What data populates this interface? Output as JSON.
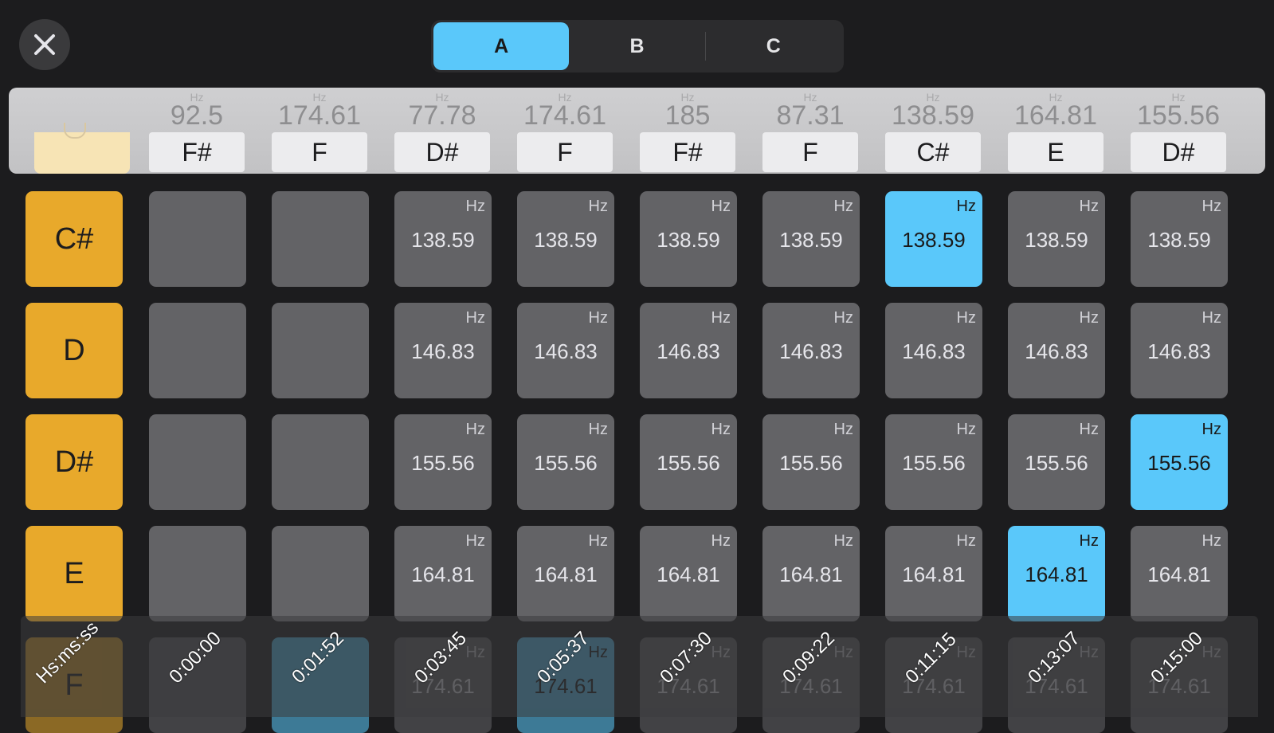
{
  "segments": {
    "a": "A",
    "b": "B",
    "c": "C"
  },
  "header": {
    "unit": "Hz",
    "columns": [
      {
        "freq": "92.5",
        "note": "F#"
      },
      {
        "freq": "174.61",
        "note": "F"
      },
      {
        "freq": "77.78",
        "note": "D#"
      },
      {
        "freq": "174.61",
        "note": "F"
      },
      {
        "freq": "185",
        "note": "F#"
      },
      {
        "freq": "87.31",
        "note": "F"
      },
      {
        "freq": "138.59",
        "note": "C#"
      },
      {
        "freq": "164.81",
        "note": "E"
      },
      {
        "freq": "155.56",
        "note": "D#"
      }
    ]
  },
  "rows": [
    {
      "label": "C#",
      "freq": "138.59",
      "unit": "Hz"
    },
    {
      "label": "D",
      "freq": "146.83",
      "unit": "Hz"
    },
    {
      "label": "D#",
      "freq": "155.56",
      "unit": "Hz"
    },
    {
      "label": "E",
      "freq": "164.81",
      "unit": "Hz"
    },
    {
      "label": "F",
      "freq": "174.61",
      "unit": "Hz"
    }
  ],
  "timeline": {
    "format": "Hs:ms:ss",
    "ticks": [
      "0:00:00",
      "0:01:52",
      "0:03:45",
      "0:05:37",
      "0:07:30",
      "0:09:22",
      "0:11:15",
      "0:13:07",
      "0:15:00"
    ]
  },
  "colors": {
    "accent": "#5ac8fa",
    "row_label": "#e8a92b",
    "cell": "#636366",
    "background": "#1c1c1e"
  }
}
